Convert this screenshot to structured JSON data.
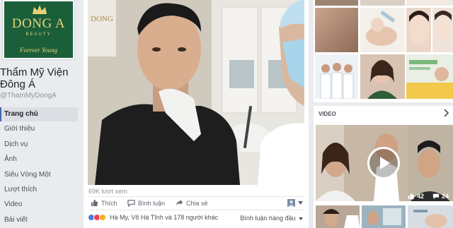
{
  "logo": {
    "brand": "DONG A",
    "sub": "BEAUTY",
    "tagline": "Forever Young"
  },
  "page": {
    "name": "Thẩm Mỹ Viện Đông Á",
    "handle": "@ThamMyDongA"
  },
  "nav": [
    {
      "label": "Trang chủ",
      "active": true
    },
    {
      "label": "Giới thiệu"
    },
    {
      "label": "Dịch vụ"
    },
    {
      "label": "Ảnh"
    },
    {
      "label": "Siêu Vòng Một"
    },
    {
      "label": "Lượt thích"
    },
    {
      "label": "Video"
    },
    {
      "label": "Bài viết"
    }
  ],
  "post": {
    "views": "69K lượt xem",
    "like_label": "Thích",
    "comment_label": "Bình luận",
    "share_label": "Chia sẻ",
    "reactions_text": "Hà My, Võ Hà Tĩnh và 178 người khác",
    "comment_sort": "Bình luận hàng đầu"
  },
  "video_section": {
    "title": "VIDEO",
    "likes": "42",
    "comments": "24"
  },
  "colors": {
    "accent": "#4267b2",
    "logo_green": "#1b5e3a",
    "logo_gold": "#e9d27a"
  },
  "icons": [
    "crown-icon",
    "like-icon",
    "comment-icon",
    "share-icon",
    "chevron-right-icon",
    "play-icon",
    "avatar-icon",
    "caret-down-icon"
  ]
}
